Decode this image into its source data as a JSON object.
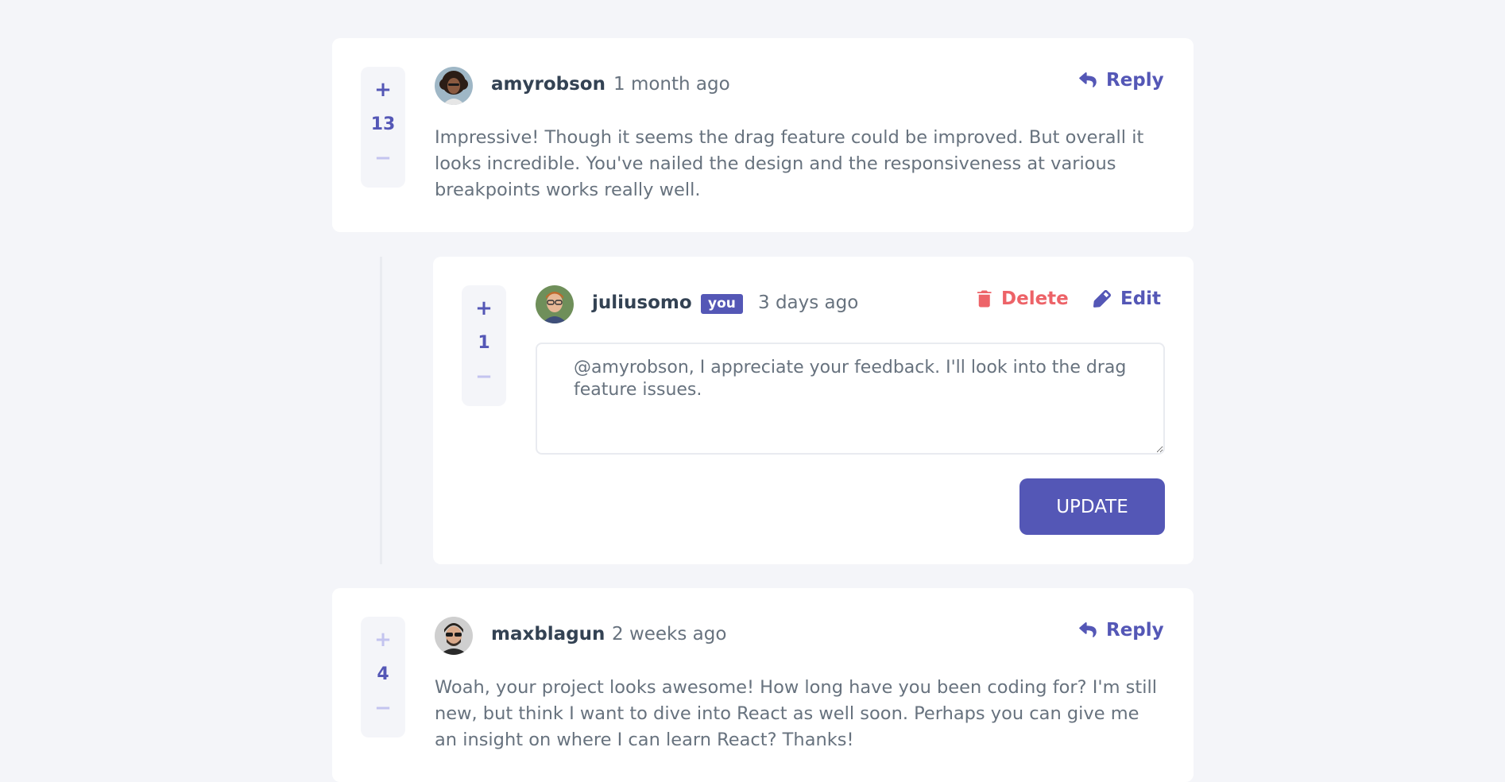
{
  "comments": [
    {
      "score": "13",
      "plus": "+",
      "minus": "−",
      "username": "amyrobson",
      "time": "1 month ago",
      "action": "Reply",
      "content": "Impressive! Though it seems the drag feature could be improved. But overall it looks incredible. You've nailed the design and the responsiveness at various breakpoints works really well."
    },
    {
      "score": "4",
      "plus": "+",
      "minus": "−",
      "username": "maxblagun",
      "time": "2 weeks ago",
      "action": "Reply",
      "content": "Woah, your project looks awesome! How long have you been coding for? I'm still new, but think I want to dive into React as well soon. Perhaps you can give me an insight on where I can learn React? Thanks!"
    }
  ],
  "reply": {
    "score": "1",
    "plus": "+",
    "minus": "−",
    "username": "juliusomo",
    "badge": "you",
    "time": "3 days ago",
    "delete_label": "Delete",
    "edit_label": "Edit",
    "edit_text": "@amyrobson, I appreciate your feedback. I'll look into the drag feature issues.",
    "update_label": "UPDATE"
  },
  "colors": {
    "accent": "#5457b6",
    "accent_light": "#c3c4ef",
    "danger": "#ed6368",
    "background": "#f4f5f9",
    "text_dark": "#334253",
    "text_muted": "#67727e"
  },
  "icons": {
    "reply": "reply-arrow-icon",
    "delete": "trash-icon",
    "edit": "pencil-icon"
  }
}
